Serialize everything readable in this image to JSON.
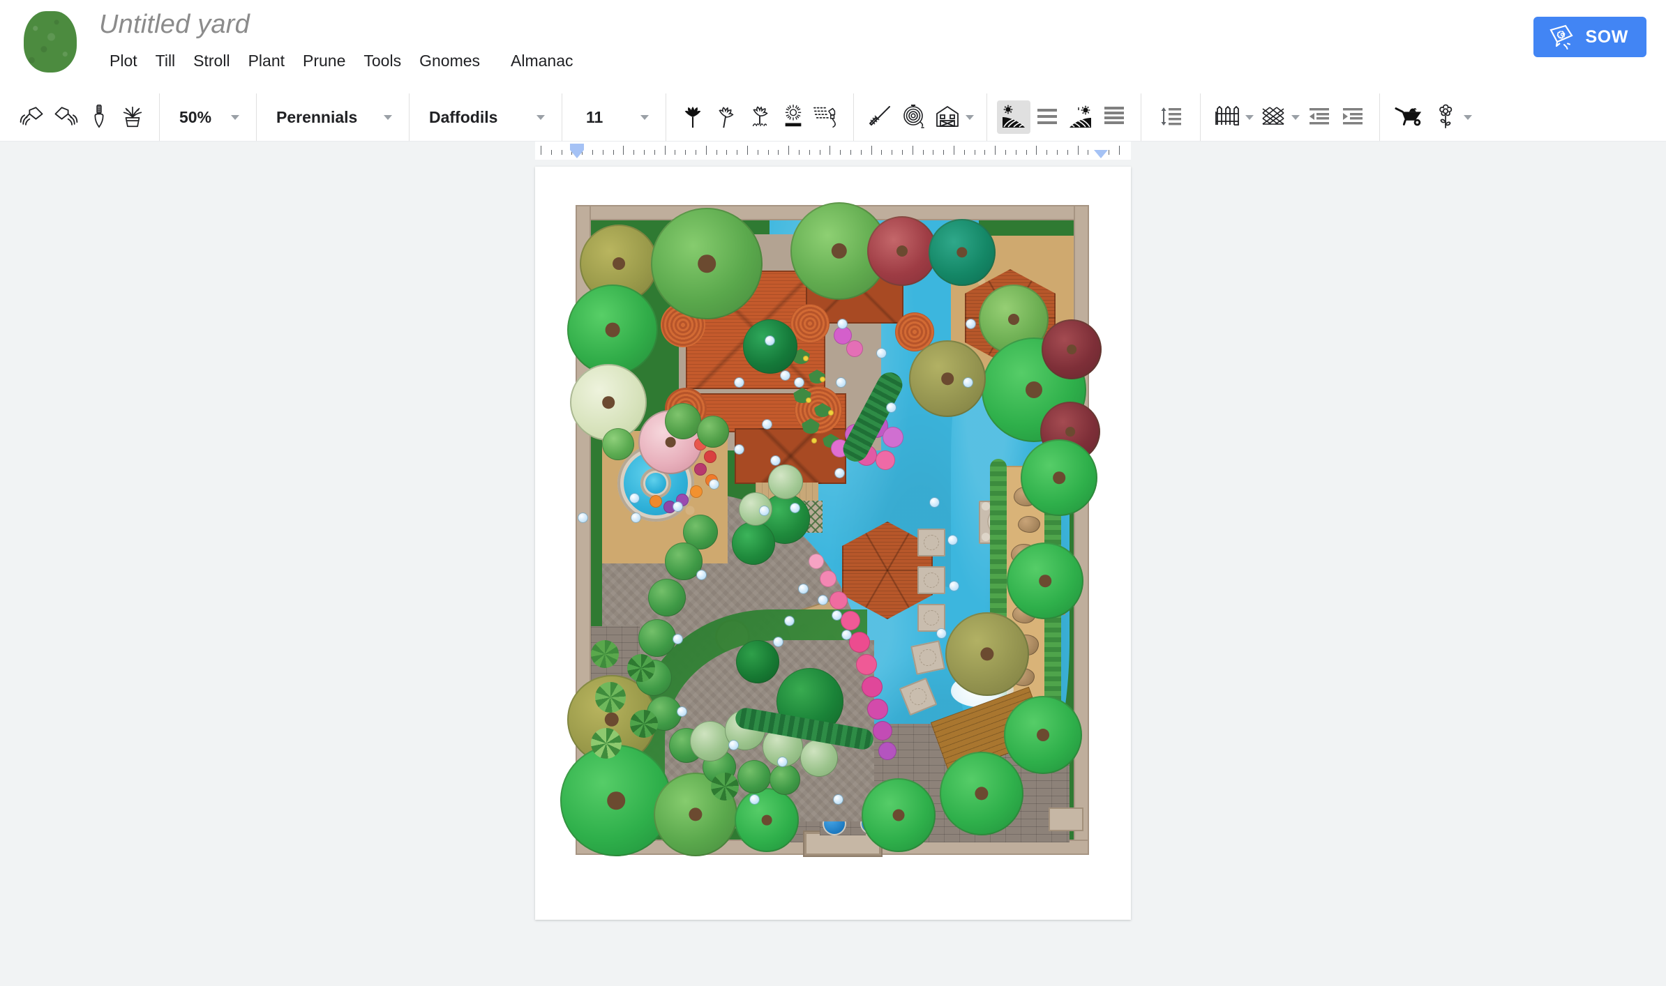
{
  "header": {
    "logo_icon": "green-leaf-logo",
    "title": "Untitled yard",
    "menu": [
      {
        "label": "Plot"
      },
      {
        "label": "Till"
      },
      {
        "label": "Stroll"
      },
      {
        "label": "Plant"
      },
      {
        "label": "Prune"
      },
      {
        "label": "Tools"
      },
      {
        "label": "Gnomes"
      },
      {
        "label": "Almanac"
      }
    ],
    "sow_button": {
      "label": "SOW",
      "icon": "seed-packet-icon",
      "color": "#4285f4"
    }
  },
  "toolbar": {
    "undo_icon": "watering-can-left-icon",
    "redo_icon": "watering-can-right-icon",
    "print_icon": "trowel-icon",
    "format_paint_icon": "potted-plant-icon",
    "zoom": {
      "value": "50%",
      "caret": "chevron-down-icon"
    },
    "family": {
      "value": "Perennials",
      "caret": "chevron-down-icon"
    },
    "kind": {
      "value": "Daffodils",
      "caret": "chevron-down-icon"
    },
    "size": {
      "value": "11",
      "caret": "chevron-down-icon"
    },
    "bold_icon": "filled-flower-icon",
    "italic_icon": "slanted-flower-icon",
    "underline_icon": "flower-with-grass-icon",
    "strike_icon": "daisy-with-bar-icon",
    "text_color_icon": "spray-nozzle-icon",
    "highlight_icon": "rake-icon",
    "link_icon": "hose-reel-icon",
    "image_icon": "barn-icon",
    "image_caret": "chevron-down-icon",
    "align_left_icon": "field-sunrise-left-icon",
    "align_left_lines_icon": "align-lines-left-icon",
    "align_right_icon": "field-sunrise-right-icon",
    "align_right_lines_icon": "align-lines-right-icon",
    "line_spacing_icon": "line-spacing-icon",
    "bulleted_list_icon": "picket-fence-icon",
    "bulleted_list_caret": "chevron-down-icon",
    "numbered_list_icon": "lattice-fence-icon",
    "numbered_list_caret": "chevron-down-icon",
    "decrease_indent_icon": "decrease-indent-icon",
    "increase_indent_icon": "increase-indent-icon",
    "clear_format_icon": "wheelbarrow-icon",
    "editing_mode_icon": "flower-stem-icon",
    "editing_mode_caret": "chevron-down-icon",
    "active_button": "field-sunrise-left-icon"
  },
  "ruler": {
    "left_indent_marker": "left-indent-marker",
    "right_indent_marker": "right-indent-marker",
    "left_marker_pct": 7.0,
    "right_marker_pct": 95.0
  },
  "canvas": {
    "page_name": "garden-plan-page",
    "plan_title": "landscape-garden-plan"
  }
}
